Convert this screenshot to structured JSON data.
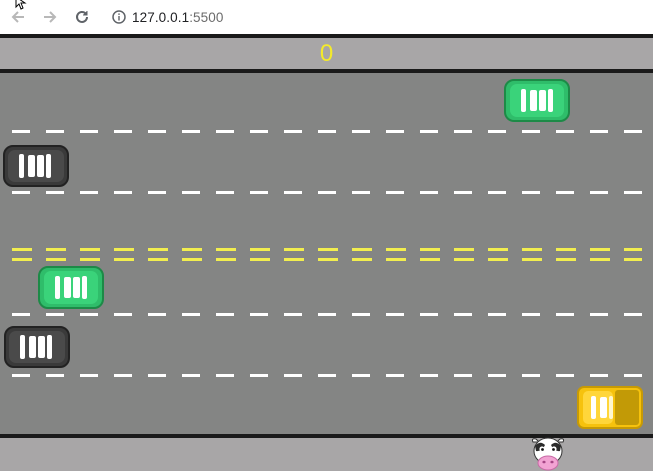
{
  "browser": {
    "url_host": "127.0.0.1",
    "url_port": ":5500",
    "back_icon": "arrow-left-icon",
    "forward_icon": "arrow-right-icon",
    "reload_icon": "reload-icon",
    "info_icon": "info-icon"
  },
  "game": {
    "score": "0",
    "colors": {
      "score": "#f4ea2a",
      "road": "#848584",
      "sidewalk": "#a8a6a7",
      "green_car": "#2fbd6a",
      "dark_car": "#3a3a3a",
      "yellow_car": "#f6c20d"
    },
    "player": "cow",
    "cars": [
      {
        "color": "green",
        "direction": "left",
        "lane": 1
      },
      {
        "color": "dark",
        "direction": "right",
        "lane": 2
      },
      {
        "color": "green",
        "direction": "right",
        "lane": 3
      },
      {
        "color": "dark",
        "direction": "right",
        "lane": 4
      },
      {
        "color": "yellow",
        "direction": "right",
        "lane": 5
      }
    ]
  }
}
